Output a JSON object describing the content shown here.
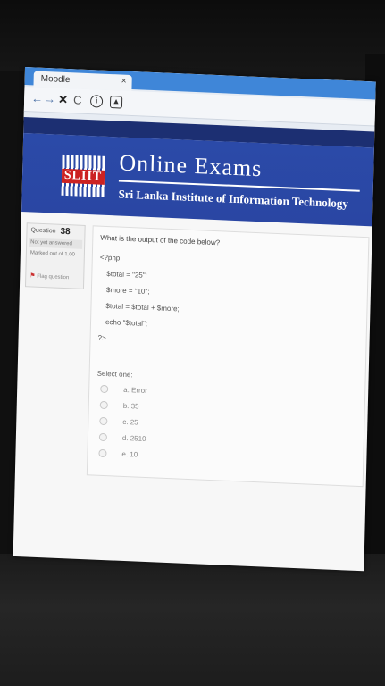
{
  "browser": {
    "tab_title": "Moodle",
    "tab_close": "×",
    "nav_back": "←",
    "nav_forward": "→",
    "nav_stop": "✕",
    "nav_reload": "C"
  },
  "header": {
    "logo_text": "SLIIT",
    "title": "Online Exams",
    "subtitle": "Sri Lanka Institute of Information Technology"
  },
  "question_info": {
    "label": "Question",
    "number": "38",
    "state": "Not yet answered",
    "marks": "Marked out of 1.00",
    "flag": "Flag question"
  },
  "question": {
    "text": "What is the output of the code below?",
    "code": [
      "<?php",
      "$total = \"25\";",
      "$more = \"10\";",
      "$total = $total + $more;",
      "echo \"$total\";",
      "?>"
    ],
    "select_label": "Select one:",
    "options": [
      "a. Error",
      "b. 35",
      "c. 25",
      "d. 2510",
      "e. 10"
    ]
  },
  "colors": {
    "banner_blue": "#2b4aa8",
    "tab_strip": "#3f86d8",
    "logo_red": "#cc2222"
  }
}
